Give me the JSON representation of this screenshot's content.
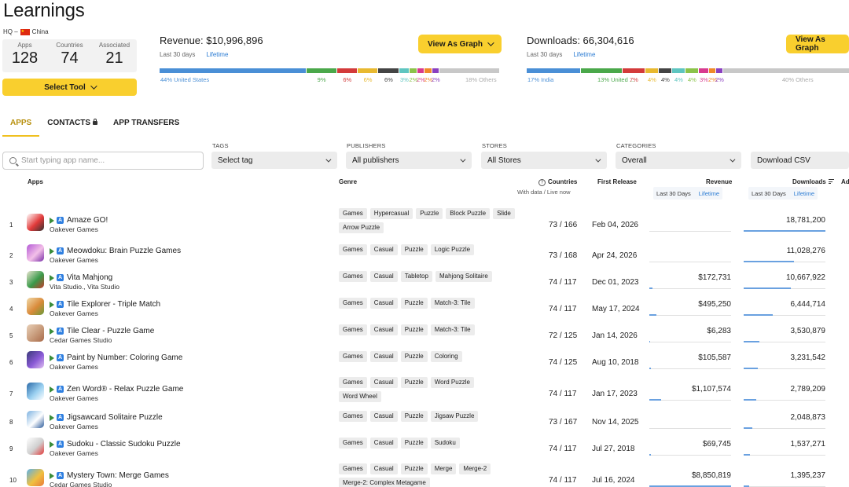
{
  "page": {
    "title": "Learnings"
  },
  "hq": {
    "label": "HQ –",
    "country": "China"
  },
  "stats": [
    {
      "label": "Apps",
      "value": "128"
    },
    {
      "label": "Countries",
      "value": "74"
    },
    {
      "label": "Associated",
      "value": "21"
    }
  ],
  "select_tool_label": "Select Tool",
  "revenue": {
    "title": "Revenue: $10,996,896",
    "period": "Last 30 days",
    "lifetime": "Lifetime",
    "graph_button": "View As Graph",
    "segments": [
      {
        "share": 44,
        "color": "#4a8fd6"
      },
      {
        "share": 9,
        "color": "#4aa84a"
      },
      {
        "share": 6,
        "color": "#d33a3a"
      },
      {
        "share": 6,
        "color": "#e8b930"
      },
      {
        "share": 6,
        "color": "#444444"
      },
      {
        "share": 3,
        "color": "#5ec5c0"
      },
      {
        "share": 2,
        "color": "#8bc34a"
      },
      {
        "share": 2,
        "color": "#d83a8f"
      },
      {
        "share": 2,
        "color": "#f08a2a"
      },
      {
        "share": 2,
        "color": "#8a3fc0"
      },
      {
        "share": 18,
        "color": "#c8c8c8"
      }
    ],
    "labels": [
      "44% United States",
      "9%",
      "6%",
      "6%",
      "6%",
      "3%",
      "2%",
      "2%",
      "2%",
      "2%",
      "18% Others"
    ]
  },
  "downloads": {
    "title": "Downloads: 66,304,616",
    "period": "Last 30 days",
    "lifetime": "Lifetime",
    "graph_button": "View As Graph",
    "segments": [
      {
        "share": 17,
        "color": "#4a8fd6"
      },
      {
        "share": 13,
        "color": "#4aa84a"
      },
      {
        "share": 7,
        "color": "#d33a3a"
      },
      {
        "share": 4,
        "color": "#e8b930"
      },
      {
        "share": 4,
        "color": "#444444"
      },
      {
        "share": 4,
        "color": "#5ec5c0"
      },
      {
        "share": 4,
        "color": "#8bc34a"
      },
      {
        "share": 3,
        "color": "#d83a8f"
      },
      {
        "share": 2,
        "color": "#f08a2a"
      },
      {
        "share": 2,
        "color": "#8a3fc0"
      },
      {
        "share": 40,
        "color": "#c8c8c8"
      }
    ],
    "labels": [
      "17% India",
      "13% United ...",
      "7%",
      "4%",
      "4%",
      "4%",
      "4%",
      "3%",
      "2%",
      "2%",
      "40% Others"
    ]
  },
  "tabs": [
    "APPS",
    "CONTACTS",
    "APP TRANSFERS"
  ],
  "search": {
    "placeholder": "Start typing app name..."
  },
  "filters": [
    {
      "label": "TAGS",
      "value": "Select tag"
    },
    {
      "label": "PUBLISHERS",
      "value": "All publishers"
    },
    {
      "label": "STORES",
      "value": "All Stores"
    },
    {
      "label": "CATEGORIES",
      "value": "Overall"
    }
  ],
  "download_csv": "Download CSV",
  "table": {
    "headers": {
      "apps": "Apps",
      "genre": "Genre",
      "countries": "Countries",
      "countries_sub": "With data / Live now",
      "first_release": "First Release",
      "revenue": "Revenue",
      "downloads": "Downloads",
      "cut": "Ad",
      "last30": "Last 30 Days",
      "lifetime": "Lifetime"
    },
    "rows": [
      {
        "rank": "1",
        "name": "Amaze GO!",
        "publisher": "Oakever Games",
        "genres": [
          "Games",
          "Hypercasual",
          "Puzzle",
          "Block Puzzle",
          "Slide",
          "Arrow Puzzle"
        ],
        "countries": "73 / 166",
        "release": "Feb 04, 2026",
        "revenue": "",
        "downloads": "18,781,200",
        "rev_share": 0,
        "dl_share": 1.0,
        "icon": [
          "#ffffff",
          "#e23a3a",
          "#333333"
        ]
      },
      {
        "rank": "2",
        "name": "Meowdoku: Brain Puzzle Games",
        "publisher": "Oakever Games",
        "genres": [
          "Games",
          "Casual",
          "Puzzle",
          "Logic Puzzle"
        ],
        "countries": "73 / 168",
        "release": "Apr 24, 2026",
        "revenue": "",
        "downloads": "11,028,276",
        "rev_share": 0,
        "dl_share": 0.62,
        "icon": [
          "#b35ad6",
          "#f3c0e8",
          "#7a2fa8"
        ]
      },
      {
        "rank": "3",
        "name": "Vita Mahjong",
        "publisher": "Vita Studio., Vita Studio",
        "genres": [
          "Games",
          "Casual",
          "Tabletop",
          "Mahjong Solitaire"
        ],
        "countries": "74 / 117",
        "release": "Dec 01, 2023",
        "revenue": "$172,731",
        "downloads": "10,667,922",
        "rev_share": 0.04,
        "dl_share": 0.58,
        "icon": [
          "#e8e3cf",
          "#3a9a4a",
          "#c23a2a"
        ]
      },
      {
        "rank": "4",
        "name": "Tile Explorer - Triple Match",
        "publisher": "Oakever Games",
        "genres": [
          "Games",
          "Casual",
          "Puzzle",
          "Match-3: Tile"
        ],
        "countries": "74 / 117",
        "release": "May 17, 2024",
        "revenue": "$495,250",
        "downloads": "6,444,714",
        "rev_share": 0.09,
        "dl_share": 0.36,
        "icon": [
          "#f0d9a8",
          "#d98a3a",
          "#6a9a3a"
        ]
      },
      {
        "rank": "5",
        "name": "Tile Clear - Puzzle Game",
        "publisher": "Cedar Games Studio",
        "genres": [
          "Games",
          "Casual",
          "Puzzle",
          "Match-3: Tile"
        ],
        "countries": "72 / 125",
        "release": "Jan 14, 2026",
        "revenue": "$6,283",
        "downloads": "3,530,879",
        "rev_share": 0.01,
        "dl_share": 0.19,
        "icon": [
          "#e8d0b8",
          "#c79a7a",
          "#a86a4a"
        ]
      },
      {
        "rank": "6",
        "name": "Paint by Number: Coloring Game",
        "publisher": "Oakever Games",
        "genres": [
          "Games",
          "Casual",
          "Puzzle",
          "Coloring"
        ],
        "countries": "74 / 125",
        "release": "Aug 10, 2018",
        "revenue": "$105,587",
        "downloads": "3,231,542",
        "rev_share": 0.02,
        "dl_share": 0.17,
        "icon": [
          "#3a3a7a",
          "#8a5ad6",
          "#e0c0f0"
        ]
      },
      {
        "rank": "7",
        "name": "Zen Word® - Relax Puzzle Game",
        "publisher": "Oakever Games",
        "genres": [
          "Games",
          "Casual",
          "Puzzle",
          "Word Puzzle",
          "Word Wheel"
        ],
        "countries": "74 / 117",
        "release": "Jan 17, 2023",
        "revenue": "$1,107,574",
        "downloads": "2,789,209",
        "rev_share": 0.14,
        "dl_share": 0.15,
        "icon": [
          "#2a6aa8",
          "#9ad0f0",
          "#ffffff"
        ]
      },
      {
        "rank": "8",
        "name": "Jigsawcard Solitaire Puzzle",
        "publisher": "Oakever Games",
        "genres": [
          "Games",
          "Casual",
          "Puzzle",
          "Jigsaw Puzzle"
        ],
        "countries": "73 / 167",
        "release": "Nov 14, 2025",
        "revenue": "",
        "downloads": "2,048,873",
        "rev_share": 0,
        "dl_share": 0.11,
        "icon": [
          "#7ab0e0",
          "#ffffff",
          "#2a5a9a"
        ]
      },
      {
        "rank": "9",
        "name": "Sudoku - Classic Sudoku Puzzle",
        "publisher": "Oakever Games",
        "genres": [
          "Games",
          "Casual",
          "Puzzle",
          "Sudoku"
        ],
        "countries": "74 / 117",
        "release": "Jul 27, 2018",
        "revenue": "$69,745",
        "downloads": "1,537,271",
        "rev_share": 0.02,
        "dl_share": 0.08,
        "icon": [
          "#ffffff",
          "#d0d0d0",
          "#e23a3a"
        ]
      },
      {
        "rank": "10",
        "name": "Mystery Town: Merge Games",
        "publisher": "Cedar Games Studio",
        "genres": [
          "Games",
          "Casual",
          "Puzzle",
          "Merge",
          "Merge-2",
          "Merge-2: Complex Metagame"
        ],
        "countries": "74 / 117",
        "release": "Jul 16, 2024",
        "revenue": "$8,850,819",
        "downloads": "1,395,237",
        "rev_share": 1.0,
        "dl_share": 0.07,
        "icon": [
          "#5ab0e8",
          "#f0c040",
          "#e87a3a"
        ]
      }
    ]
  }
}
